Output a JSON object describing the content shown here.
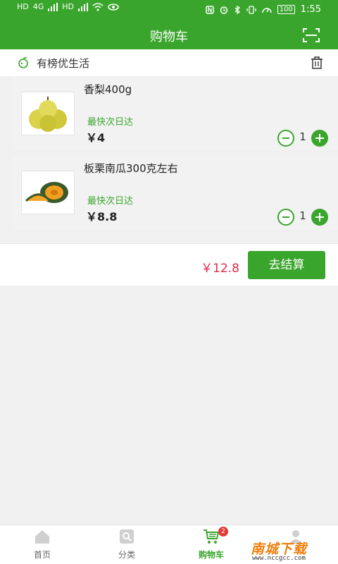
{
  "status_bar": {
    "time": "1:55",
    "battery": "100",
    "network_left": [
      "HD",
      "HD"
    ],
    "network_gen": "4G"
  },
  "header": {
    "title": "购物车",
    "scan_icon": "scan-icon"
  },
  "store": {
    "name": "有榜优生活",
    "leaf_icon": "leaf-icon",
    "trash_icon": "trash-icon"
  },
  "items": [
    {
      "name": "香梨400g",
      "tag": "最快次日达",
      "price": "￥4",
      "qty": "1",
      "thumb_icon": "pear-image"
    },
    {
      "name": "板栗南瓜300克左右",
      "tag": "最快次日达",
      "price": "￥8.8",
      "qty": "1",
      "thumb_icon": "pumpkin-image"
    }
  ],
  "checkout": {
    "total": "￥12.8",
    "button_label": "去结算"
  },
  "tabbar": {
    "tabs": [
      {
        "label": "首页",
        "icon": "home-icon",
        "active": false
      },
      {
        "label": "分类",
        "icon": "category-icon",
        "active": false
      },
      {
        "label": "购物车",
        "icon": "cart-icon",
        "active": true,
        "badge": "2"
      },
      {
        "label": "",
        "icon": "profile-icon",
        "active": false
      }
    ]
  },
  "watermark": {
    "text": "南城下载",
    "url": "www.nccgcc.com"
  },
  "colors": {
    "brand": "#3aa52c",
    "price_red": "#e0284b",
    "badge_red": "#e23a3a"
  }
}
